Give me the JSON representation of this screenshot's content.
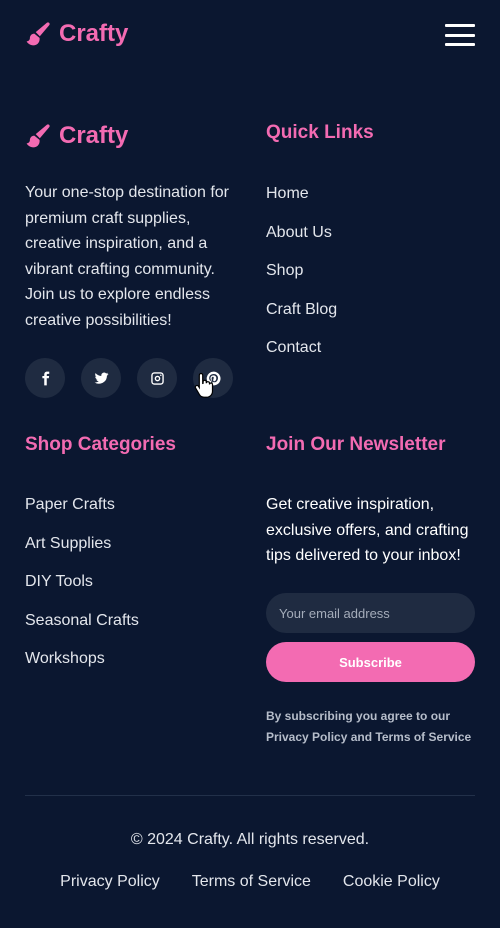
{
  "colors": {
    "background": "#0b1730",
    "accent": "#f36bb2",
    "surface": "#1f2b41"
  },
  "header": {
    "brand": "Crafty",
    "brand_icon": "paintbrush-icon",
    "menu_icon": "hamburger-menu-icon"
  },
  "about": {
    "brand": "Crafty",
    "text": "Your one-stop destination for premium craft supplies, creative inspiration, and a vibrant crafting community. Join us to explore endless creative possibilities!",
    "socials": [
      "facebook-icon",
      "twitter-icon",
      "instagram-icon",
      "pinterest-icon"
    ]
  },
  "quick_links": {
    "title": "Quick Links",
    "items": [
      "Home",
      "About Us",
      "Shop",
      "Craft Blog",
      "Contact"
    ]
  },
  "shop_categories": {
    "title": "Shop Categories",
    "items": [
      "Paper Crafts",
      "Art Supplies",
      "DIY Tools",
      "Seasonal Crafts",
      "Workshops"
    ]
  },
  "newsletter": {
    "title": "Join Our Newsletter",
    "text": "Get creative inspiration, exclusive offers, and crafting tips delivered to your inbox!",
    "email_placeholder": "Your email address",
    "button": "Subscribe",
    "consent": "By subscribing you agree to our Privacy Policy and Terms of Service"
  },
  "bottom": {
    "copyright": "© 2024 Crafty. All rights reserved.",
    "links": [
      "Privacy Policy",
      "Terms of Service",
      "Cookie Policy"
    ]
  }
}
